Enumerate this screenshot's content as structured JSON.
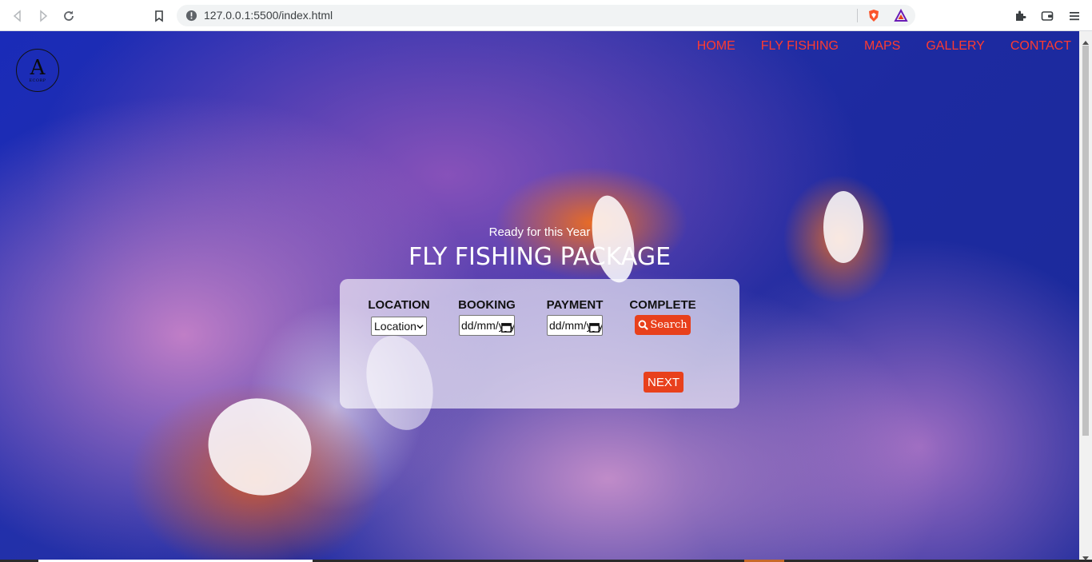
{
  "browser": {
    "url": "127.0.0.1:5500/index.html"
  },
  "site": {
    "logo": {
      "letter": "A",
      "sub": "ECORP"
    },
    "nav": [
      "HOME",
      "FLY FISHING",
      "MAPS",
      "GALLERY",
      "CONTACT"
    ],
    "hero": {
      "subtitle": "Ready for this Year",
      "title": "FLY FISHING PACKAGE"
    },
    "booking": {
      "location_label": "LOCATION",
      "location_value": "Location",
      "booking_label": "BOOKING",
      "booking_value": "dd/mm/yyyy",
      "payment_label": "PAYMENT",
      "payment_value": "dd/mm/yyyy",
      "complete_label": "COMPLETE",
      "search_label": "Search",
      "next_label": "NEXT"
    }
  },
  "colors": {
    "nav_link": "#ff3b30",
    "button": "#e8401c",
    "background": "#1d2aa0"
  }
}
